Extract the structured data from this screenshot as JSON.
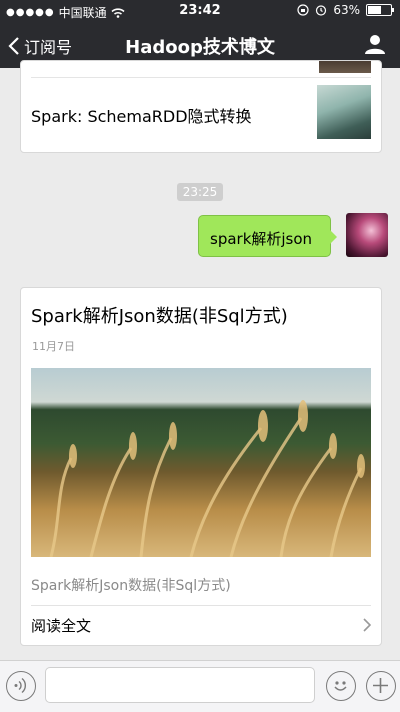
{
  "status": {
    "carrier": "中国联通",
    "time": "23:42",
    "battery": "63%",
    "battery_level": 0.63
  },
  "nav": {
    "back_label": "订阅号",
    "title": "Hadoop技术博文"
  },
  "feed": {
    "prev_article_title": "Spark: SchemaRDD隐式转换",
    "timestamp": "23:25",
    "message_text": "spark解析json",
    "article": {
      "title": "Spark解析Json数据(非Sql方式)",
      "date": "11月7日",
      "summary": "Spark解析Json数据(非Sql方式)",
      "read_more": "阅读全文"
    }
  },
  "icons": {
    "back": "chevron-left-icon",
    "user": "user-icon",
    "voice": "voice-icon",
    "emoji": "emoji-icon",
    "plus": "plus-icon",
    "arrow": "chevron-right-icon"
  },
  "colors": {
    "nav_bg": "#2a2b2f",
    "bubble": "#a0e75a"
  }
}
